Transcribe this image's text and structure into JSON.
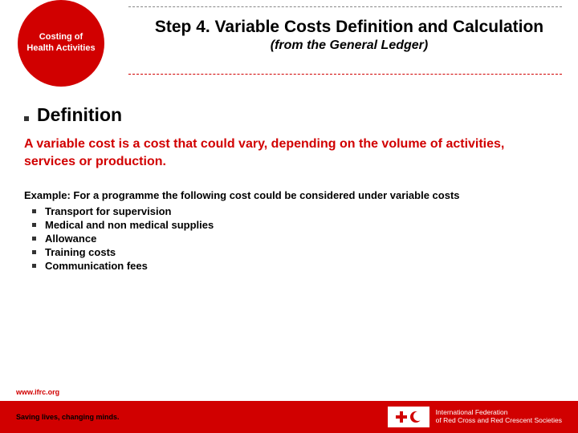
{
  "circle": {
    "label": "Costing of Health Activities"
  },
  "title": {
    "main": "Step 4. Variable Costs Definition and Calculation",
    "sub": "(from the General Ledger)"
  },
  "section": {
    "heading": "Definition",
    "body": "A variable cost is a cost that could vary, depending on the volume of activities, services or production."
  },
  "example": {
    "lead": "Example: For a programme the following cost could be considered under variable costs",
    "items": [
      "Transport for supervision",
      "Medical and non medical supplies",
      "Allowance",
      "Training costs",
      "Communication fees"
    ]
  },
  "footer": {
    "url": "www.ifrc.org",
    "tagline": "Saving lives, changing minds.",
    "org_line1": "International Federation",
    "org_line2": "of Red Cross and Red Crescent Societies"
  }
}
